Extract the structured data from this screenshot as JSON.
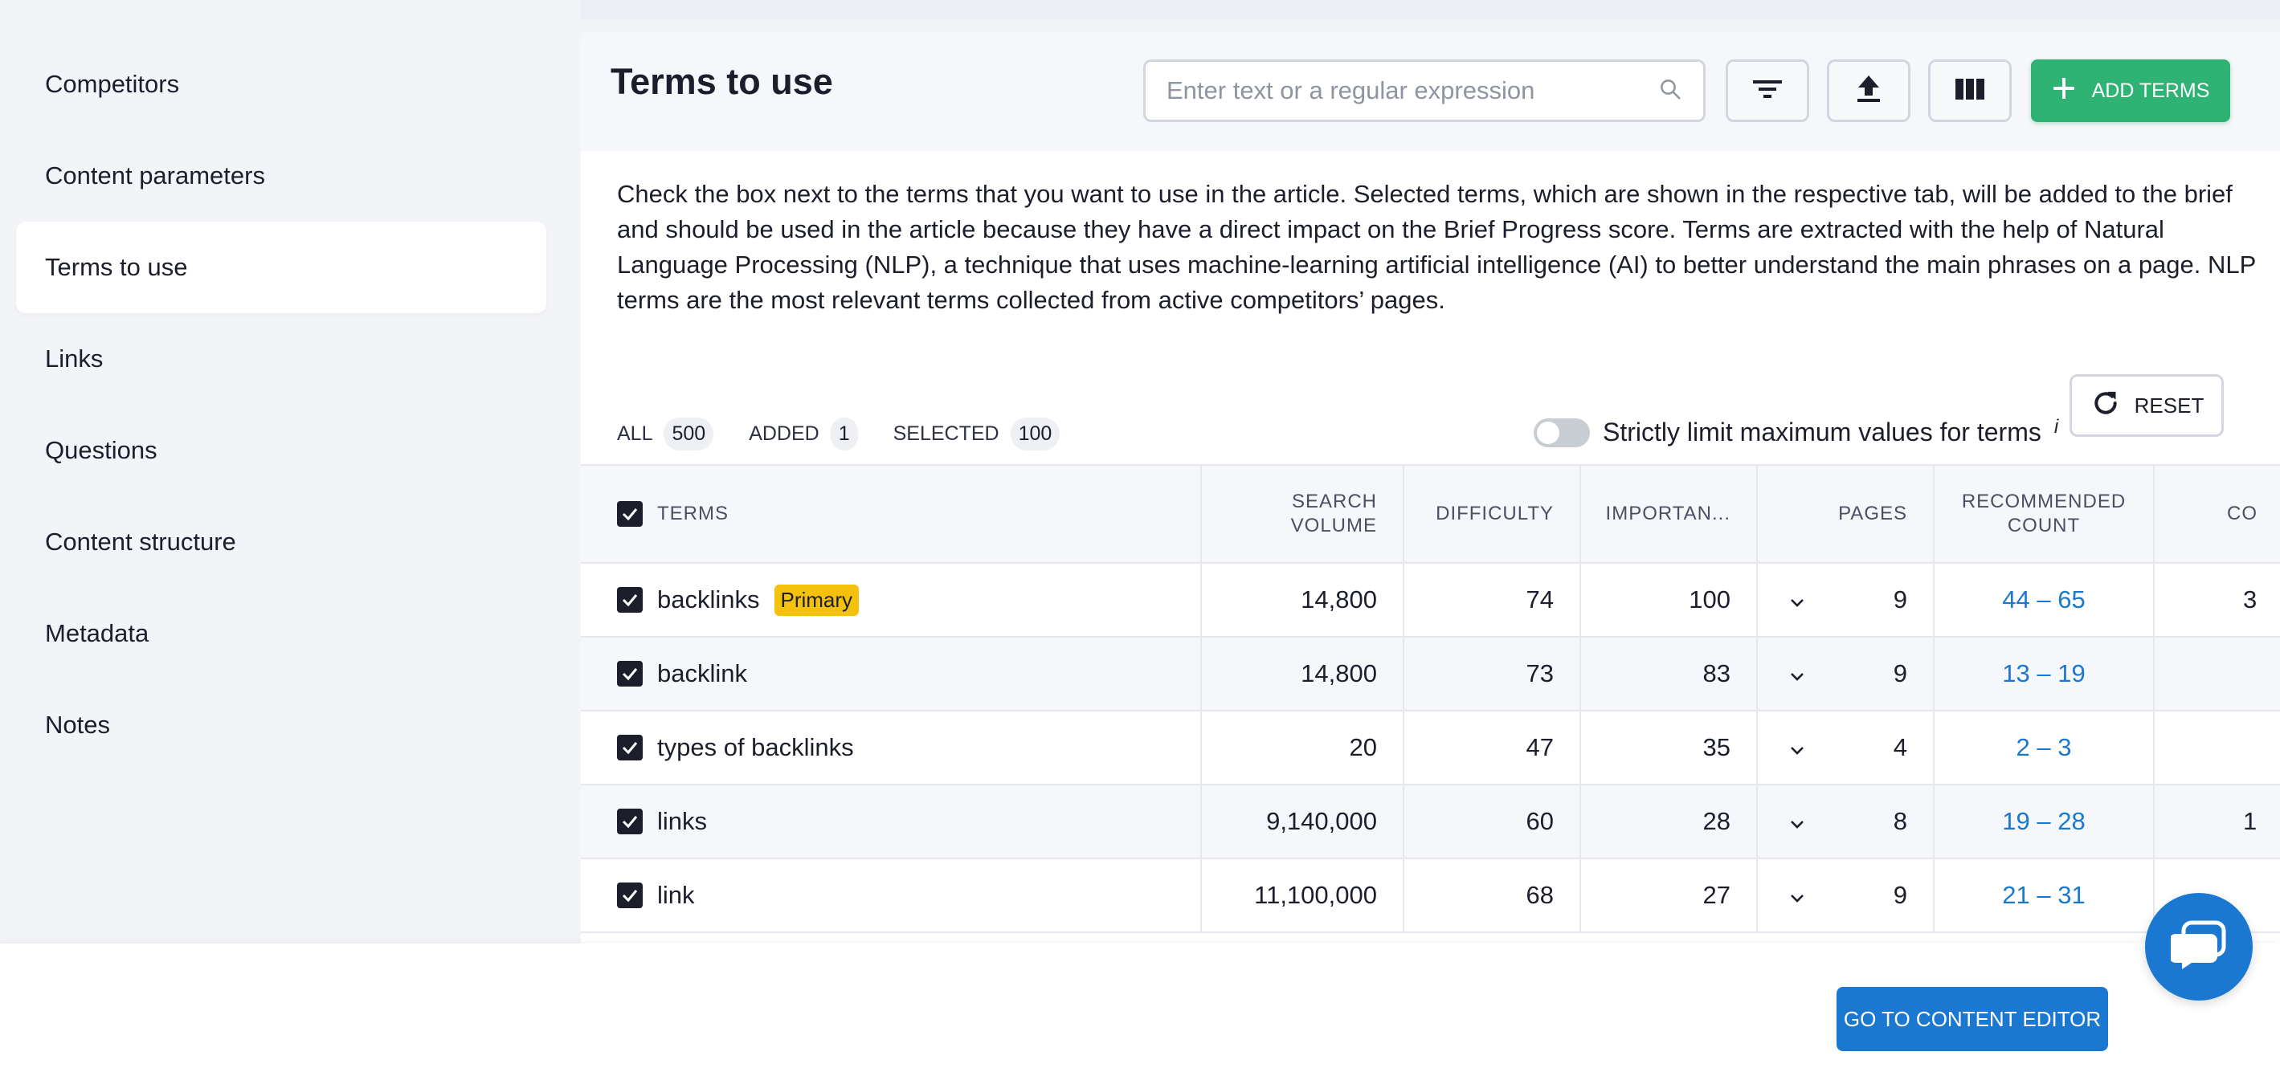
{
  "sidebar": {
    "items": [
      {
        "label": "Competitors"
      },
      {
        "label": "Content parameters"
      },
      {
        "label": "Terms to use",
        "active": true
      },
      {
        "label": "Links"
      },
      {
        "label": "Questions"
      },
      {
        "label": "Content structure"
      },
      {
        "label": "Metadata"
      },
      {
        "label": "Notes"
      }
    ]
  },
  "header": {
    "title": "Terms to use",
    "search_placeholder": "Enter text or a regular expression",
    "add_terms_label": "ADD TERMS"
  },
  "description": "Check the box next to the terms that you want to use in the article. Selected terms, which are shown in the respective tab, will be added to the brief and should be used in the article because they have a direct impact on the Brief Progress score. Terms are extracted with the help of Natural Language Processing (NLP), a technique that uses machine-learning artificial intelligence (AI) to better understand the main phrases on a page. NLP terms are the most relevant terms collected from active competitors’ pages.",
  "tabs": [
    {
      "label": "ALL",
      "count": "500",
      "active": true
    },
    {
      "label": "ADDED",
      "count": "1"
    },
    {
      "label": "SELECTED",
      "count": "100"
    }
  ],
  "toggle": {
    "label": "Strictly limit maximum values for terms",
    "info": "i",
    "on": false
  },
  "reset_label": "RESET",
  "table": {
    "headers": {
      "terms": "TERMS",
      "search_volume_1": "SEARCH",
      "search_volume_2": "VOLUME",
      "difficulty": "DIFFICULTY",
      "importance": "IMPORTAN...",
      "pages": "PAGES",
      "recommended_1": "RECOMMENDED",
      "recommended_2": "COUNT",
      "last": "CO"
    },
    "rows": [
      {
        "term": "backlinks",
        "badge": "Primary",
        "volume": "14,800",
        "difficulty": "74",
        "importance": "100",
        "pages": "9",
        "recommended": "44 – 65",
        "last": "3"
      },
      {
        "term": "backlink",
        "volume": "14,800",
        "difficulty": "73",
        "importance": "83",
        "pages": "9",
        "recommended": "13 – 19",
        "last": ""
      },
      {
        "term": "types of backlinks",
        "volume": "20",
        "difficulty": "47",
        "importance": "35",
        "pages": "4",
        "recommended": "2 – 3",
        "last": ""
      },
      {
        "term": "links",
        "volume": "9,140,000",
        "difficulty": "60",
        "importance": "28",
        "pages": "8",
        "recommended": "19 – 28",
        "last": "1"
      },
      {
        "term": "link",
        "volume": "11,100,000",
        "difficulty": "68",
        "importance": "27",
        "pages": "9",
        "recommended": "21 – 31",
        "last": ""
      }
    ]
  },
  "footer": {
    "goto_label": "GO TO CONTENT EDITOR"
  },
  "colors": {
    "accent_blue": "#1b78d0",
    "accent_green": "#2fb374",
    "badge_yellow": "#f4c20d"
  }
}
